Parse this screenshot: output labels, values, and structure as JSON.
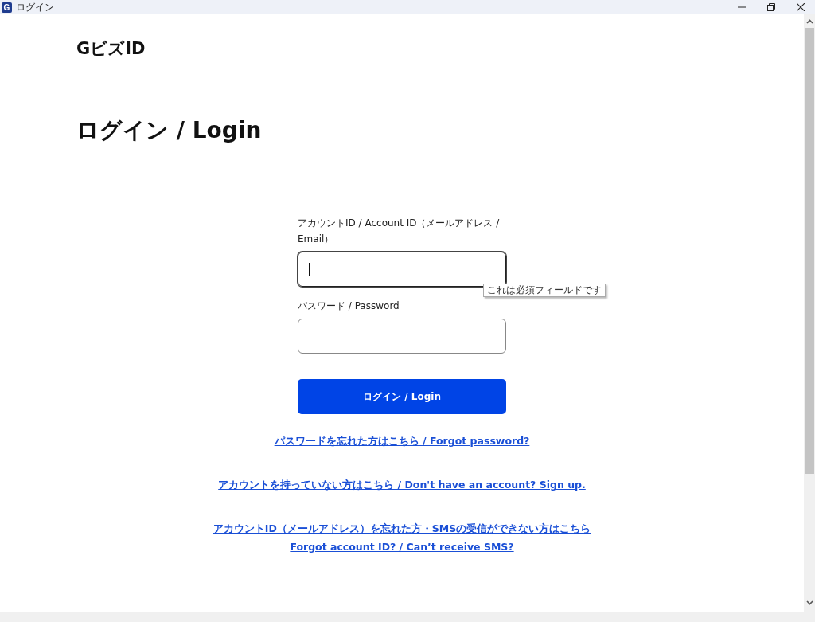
{
  "window": {
    "icon_letter": "G",
    "title": "ログイン"
  },
  "logo": "GビズID",
  "heading": "ログイン / Login",
  "form": {
    "fields": [
      {
        "label": "アカウントID / Account ID（メールアドレス / Email）",
        "focused": true,
        "tooltip": "これは必須フィールドです"
      },
      {
        "label": "パスワード / Password",
        "focused": false
      }
    ],
    "submit": "ログイン / Login"
  },
  "links": [
    {
      "lines": [
        "パスワードを忘れた方はこちら / Forgot password?"
      ]
    },
    {
      "lines": [
        "アカウントを持っていない方はこちら / Don't have an account? Sign up."
      ]
    },
    {
      "lines": [
        "アカウントID（メールアドレス）を忘れた方・SMSの受信ができない方はこちら",
        "Forgot account ID? / Can’t receive SMS?"
      ]
    }
  ]
}
